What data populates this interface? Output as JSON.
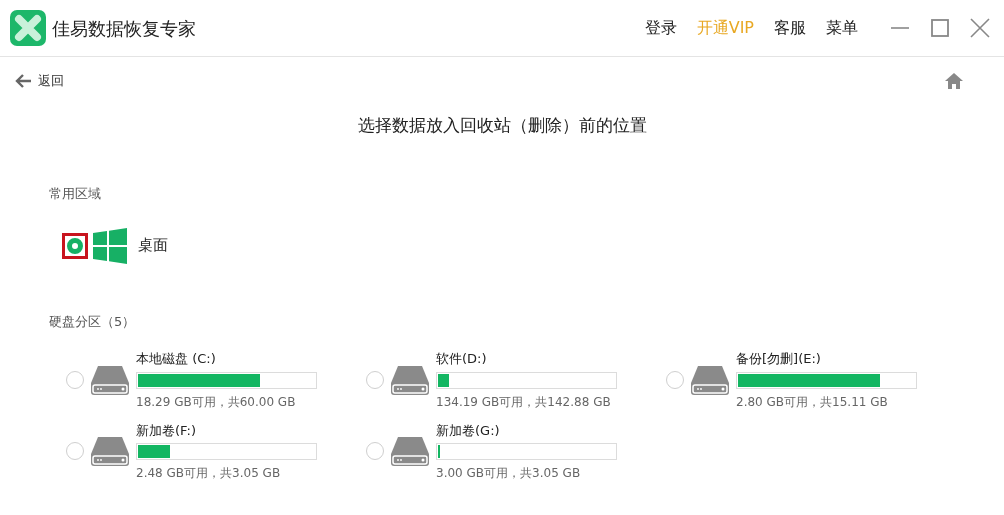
{
  "app": {
    "title": "佳易数据恢复专家"
  },
  "header_links": [
    {
      "label": "登录",
      "kind": "normal"
    },
    {
      "label": "开通VIP",
      "kind": "vip"
    },
    {
      "label": "客服",
      "kind": "normal"
    },
    {
      "label": "菜单",
      "kind": "normal"
    }
  ],
  "back": {
    "label": "返回"
  },
  "heading": "选择数据放入回收站（删除）前的位置",
  "common_area": {
    "title": "常用区域",
    "items": [
      {
        "label": "桌面",
        "selected": true
      }
    ]
  },
  "partitions": {
    "title": "硬盘分区（5）",
    "drives": [
      {
        "name": "本地磁盘 (C:)",
        "level": 0.69,
        "usage": "18.29 GB可用，共60.00 GB",
        "selected": false
      },
      {
        "name": "软件(D:)",
        "level": 0.06,
        "usage": "134.19 GB可用，共142.88 GB",
        "selected": false
      },
      {
        "name": "备份[勿删](E:)",
        "level": 0.8,
        "usage": "2.80 GB可用，共15.11 GB",
        "selected": false
      },
      {
        "name": "新加卷(F:)",
        "level": 0.18,
        "usage": "2.48 GB可用，共3.05 GB",
        "selected": false
      },
      {
        "name": "新加卷(G:)",
        "level": 0.01,
        "usage": "3.00 GB可用，共3.05 GB",
        "selected": false
      }
    ]
  }
}
